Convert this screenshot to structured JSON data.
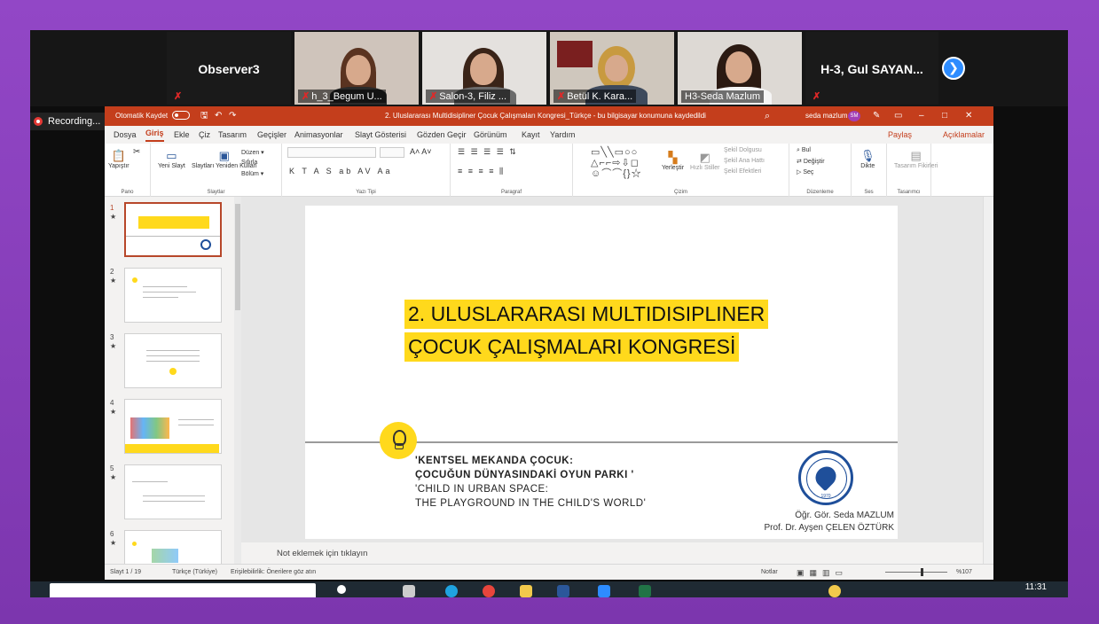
{
  "zoom": {
    "observer": "Observer3",
    "participants": [
      {
        "label": "h_3_Begum U..."
      },
      {
        "label": "Salon-3, Filiz ..."
      },
      {
        "label": "Betül K. Kara..."
      },
      {
        "label": "H3-Seda Mazlum"
      }
    ],
    "right_name": "H-3, Gul SAYAN...",
    "recording": "Recording...",
    "next_icon": "chevron-right-icon"
  },
  "ppt": {
    "title": {
      "autosave": "Otomatik Kaydet",
      "file": "2. Uluslararası Multidisipliner  Çocuk Çalışmaları  Kongresi_Türkçe  -  bu bilgisayar konumuna kaydedildi",
      "user": "seda mazlum",
      "initials": "SM"
    },
    "menu": [
      "Dosya",
      "Giriş",
      "Ekle",
      "Çiz",
      "Tasarım",
      "Geçişler",
      "Animasyonlar",
      "Slayt Gösterisi",
      "Gözden Geçir",
      "Görünüm",
      "Kayıt",
      "Yardım"
    ],
    "share": "Paylaş",
    "comments": "Açıklamalar",
    "ribbon": {
      "paste": "Yapıştır",
      "new_slide": "Yeni Slayt",
      "reuse": "Slaytları Yeniden Kullan",
      "layout": "Düzen",
      "reset": "Sıfırla",
      "section": "Bölüm",
      "arrange": "Yerleştir",
      "quick_styles": "Hızlı Stiller",
      "shape_fill": "Şekil Dolgusu",
      "shape_outline": "Şekil Ana Hattı",
      "shape_effects": "Şekil Efektleri",
      "find": "Bul",
      "replace": "Değiştir",
      "select": "Seç",
      "dictate": "Dikte",
      "designer": "Tasarım Fikirleri",
      "groups": [
        "Pano",
        "Slaytlar",
        "Yazı Tipi",
        "Paragraf",
        "Çizim",
        "Düzenleme",
        "Ses",
        "Tasarımcı"
      ]
    },
    "thumbs": [
      {
        "num": "1",
        "title": "2. ULUSLARARASI MULTIDISIPLINER ÇOCUK ÇALIŞMALARI KONGRESİ"
      },
      {
        "num": "2"
      },
      {
        "num": "3"
      },
      {
        "num": "4"
      },
      {
        "num": "5"
      },
      {
        "num": "6"
      }
    ],
    "slide": {
      "title_line1": "2. ULUSLARARASI MULTIDISIPLINER",
      "title_line2": "ÇOCUK ÇALIŞMALARI KONGRESİ",
      "sub1": "'KENTSEL MEKANDA ÇOCUK:",
      "sub2": "ÇOCUĞUN DÜNYASINDAKİ OYUN PARKI '",
      "sub3": "'CHILD IN URBAN SPACE:",
      "sub4": "THE PLAYGROUND IN THE CHILD'S WORLD'",
      "author1": "Öğr. Gör. Seda MAZLUM",
      "author2": "Prof. Dr. Ayşen ÇELEN ÖZTÜRK",
      "seal_year": "1970"
    },
    "notes": "Not eklemek için tıklayın",
    "status": {
      "slide": "Slayt 1 / 19",
      "lang": "Türkçe (Türkiye)",
      "access": "Erişilebilirlik: Önerilere göz atın",
      "notes": "Notlar",
      "zoom": "%107"
    }
  },
  "taskbar": {
    "time": "11:31"
  }
}
